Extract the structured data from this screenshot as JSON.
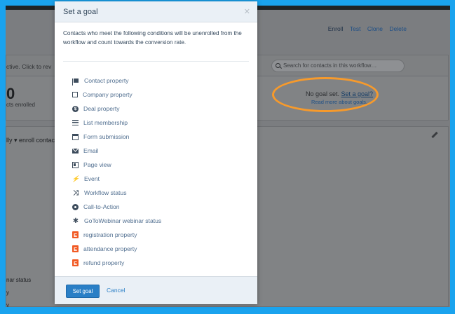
{
  "background_page": {
    "top_links": [
      "Enroll",
      "Test",
      "Clone",
      "Delete"
    ],
    "strip_text": "ctive. Click to rev",
    "search_placeholder": "Search for contacts in this workflow…",
    "enrolled_count": "0",
    "enrolled_label": "cts enrolled",
    "goal_status": "No goal set.",
    "goal_link": "Set a goal?",
    "goal_help_link": "Read more about goals.",
    "enroll_text": "lly ▾ enroll contac",
    "side_texts": [
      "nar status",
      "y",
      "y"
    ]
  },
  "modal": {
    "title": "Set a goal",
    "close_glyph": "✕",
    "description": "Contacts who meet the following conditions will be unenrolled from the workflow and count towards the conversion rate.",
    "options": [
      {
        "label": "Contact property",
        "icon": "flag-icon"
      },
      {
        "label": "Company property",
        "icon": "building-icon"
      },
      {
        "label": "Deal property",
        "icon": "dollar-icon"
      },
      {
        "label": "List membership",
        "icon": "list-icon"
      },
      {
        "label": "Form submission",
        "icon": "form-icon"
      },
      {
        "label": "Email",
        "icon": "envelope-icon"
      },
      {
        "label": "Page view",
        "icon": "page-icon"
      },
      {
        "label": "Event",
        "icon": "bolt-icon"
      },
      {
        "label": "Workflow status",
        "icon": "workflow-icon"
      },
      {
        "label": "Call-to-Action",
        "icon": "cta-icon"
      },
      {
        "label": "GoToWebinar webinar status",
        "icon": "gear-icon"
      },
      {
        "label": "registration property",
        "icon": "eventbrite-icon"
      },
      {
        "label": "attendance property",
        "icon": "eventbrite-icon"
      },
      {
        "label": "refund property",
        "icon": "eventbrite-icon"
      }
    ],
    "icon_glyphs": {
      "bolt": "⚡",
      "workflow": "⤨",
      "gear": "✱",
      "eventbrite": "E"
    },
    "buttons": {
      "primary": "Set goal",
      "cancel": "Cancel"
    }
  },
  "colors": {
    "frame": "#1aa3ee",
    "highlight": "#f79a2b",
    "primary_button": "#2a7fc6",
    "eventbrite": "#f15a24"
  }
}
